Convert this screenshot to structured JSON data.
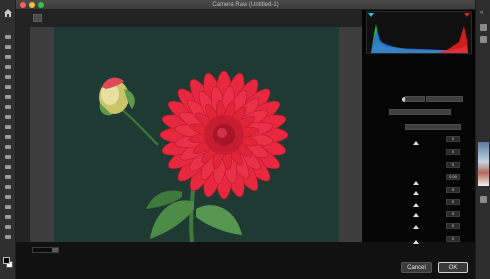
{
  "window": {
    "title": "Camera Raw (Untitled-1)"
  },
  "histogram": {
    "colors": [
      "#ff2020",
      "#30ff30",
      "#3060ff"
    ],
    "clip_left_color": "#1ec8e8",
    "clip_right_color": "#e02020"
  },
  "panel": {
    "values": [
      "0",
      "0",
      "0",
      "0.00",
      "0",
      "0",
      "0",
      "0",
      "0"
    ]
  },
  "zoom": {
    "value": ""
  },
  "buttons": {
    "cancel": "Cancel",
    "ok": "OK"
  },
  "image": {
    "subject": "red dahlia flower on dark green background",
    "background_color": "#1e3a32",
    "flower_color": "#e8283e"
  },
  "icons": {
    "home": "home-icon",
    "tools": [
      "move-icon",
      "marquee-icon",
      "lasso-icon",
      "magic-wand-icon",
      "crop-icon",
      "eyedropper-icon",
      "healing-brush-icon",
      "brush-icon",
      "clone-stamp-icon",
      "history-brush-icon",
      "eraser-icon",
      "gradient-icon",
      "blur-icon",
      "dodge-icon",
      "pen-icon",
      "type-icon",
      "path-select-icon",
      "rectangle-icon",
      "hand-icon",
      "zoom-icon",
      "more-icon"
    ]
  }
}
